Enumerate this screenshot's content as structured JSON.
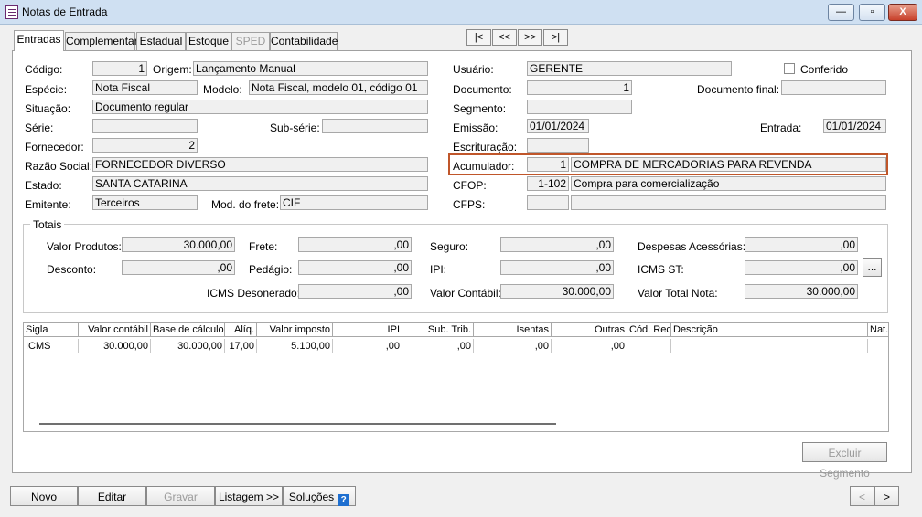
{
  "window": {
    "title": "Notas de Entrada",
    "minimize_label": "—",
    "restore_label": "▫",
    "close_label": "X"
  },
  "tabs": [
    {
      "label": "Entradas"
    },
    {
      "label": "Complementar"
    },
    {
      "label": "Estadual"
    },
    {
      "label": "Estoque"
    },
    {
      "label": "SPED"
    },
    {
      "label": "Contabilidade"
    }
  ],
  "nav": {
    "first": "|<",
    "prev": "<<",
    "next": ">>",
    "last": ">|"
  },
  "form": {
    "codigo_label": "Código:",
    "codigo": "1",
    "origem_label": "Origem:",
    "origem": "Lançamento Manual",
    "especie_label": "Espécie:",
    "especie": "Nota Fiscal",
    "modelo_label": "Modelo:",
    "modelo": "Nota Fiscal, modelo 01, código 01",
    "situacao_label": "Situação:",
    "situacao": "Documento regular",
    "serie_label": "Série:",
    "serie": "",
    "subserie_label": "Sub-série:",
    "subserie": "",
    "fornecedor_label": "Fornecedor:",
    "fornecedor": "2",
    "razao_label": "Razão Social:",
    "razao": "FORNECEDOR DIVERSO",
    "estado_label": "Estado:",
    "estado": "SANTA CATARINA",
    "emitente_label": "Emitente:",
    "emitente": "Terceiros",
    "frete_label": "Mod. do frete:",
    "frete": "CIF",
    "usuario_label": "Usuário:",
    "usuario": "GERENTE",
    "conferido_label": "Conferido",
    "documento_label": "Documento:",
    "documento": "1",
    "docfinal_label": "Documento final:",
    "docfinal": "",
    "segmento_label": "Segmento:",
    "segmento": "",
    "emissao_label": "Emissão:",
    "emissao": "01/01/2024",
    "entrada_label": "Entrada:",
    "entrada": "01/01/2024",
    "escrituracao_label": "Escrituração:",
    "escrituracao": "",
    "acumulador_label": "Acumulador:",
    "acumulador_cod": "1",
    "acumulador_desc": "COMPRA DE MERCADORIAS PARA REVENDA",
    "cfop_label": "CFOP:",
    "cfop_cod": "1-102",
    "cfop_desc": "Compra para comercialização",
    "cfps_label": "CFPS:",
    "cfps_cod": "",
    "cfps_desc": ""
  },
  "totais": {
    "title": "Totais",
    "valor_produtos_label": "Valor Produtos:",
    "valor_produtos": "30.000,00",
    "frete_label": "Frete:",
    "frete": ",00",
    "seguro_label": "Seguro:",
    "seguro": ",00",
    "despesas_label": "Despesas Acessórias:",
    "despesas": ",00",
    "desconto_label": "Desconto:",
    "desconto": ",00",
    "pedagio_label": "Pedágio:",
    "pedagio": ",00",
    "ipi_label": "IPI:",
    "ipi": ",00",
    "icmsst_label": "ICMS ST:",
    "icmsst": ",00",
    "icmsst_btn": "...",
    "icmsdes_label": "ICMS Desonerado:",
    "icmsdes": ",00",
    "contabil_label": "Valor Contábil:",
    "contabil": "30.000,00",
    "total_label": "Valor Total Nota:",
    "total": "30.000,00"
  },
  "grid": {
    "headers": [
      "Sigla",
      "Valor contábil",
      "Base de cálculo",
      "Alíq.",
      "Valor imposto",
      "IPI",
      "Sub. Trib.",
      "Isentas",
      "Outras",
      "Cód. Rec.",
      "Descrição",
      "Nat."
    ],
    "rows": [
      [
        "ICMS",
        "30.000,00",
        "30.000,00",
        "17,00",
        "5.100,00",
        ",00",
        ",00",
        ",00",
        ",00",
        "",
        "",
        ""
      ]
    ]
  },
  "buttons": {
    "excluir_segmento": "Excluir Segmento",
    "novo": "Novo",
    "editar": "Editar",
    "gravar": "Gravar",
    "listagem": "Listagem >>",
    "solucoes": "Soluções",
    "help": "?",
    "prev": "<",
    "next": ">"
  }
}
